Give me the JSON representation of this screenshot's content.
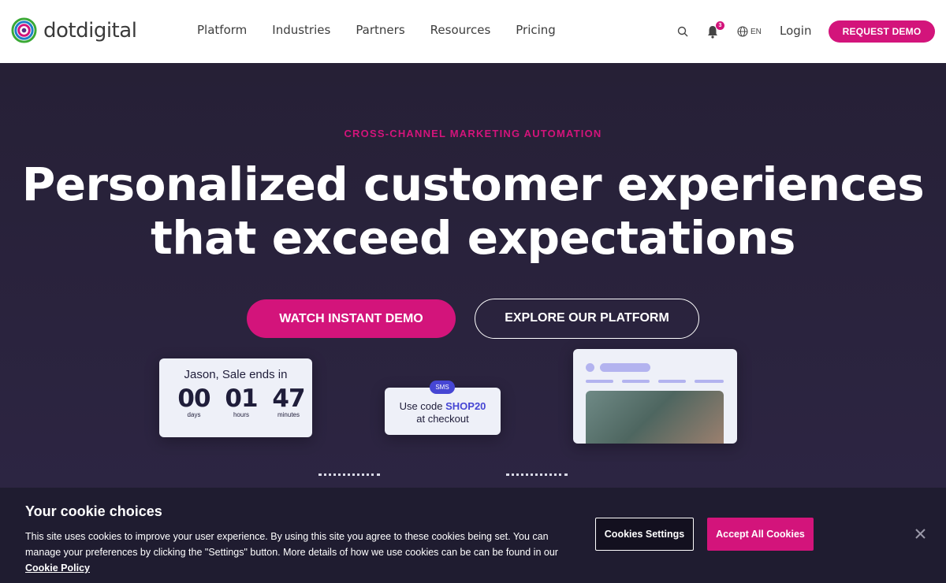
{
  "header": {
    "brand": "dotdigital",
    "nav": [
      "Platform",
      "Industries",
      "Partners",
      "Resources",
      "Pricing"
    ],
    "notification_count": "3",
    "language": "EN",
    "login_label": "Login",
    "request_demo_label": "REQUEST DEMO"
  },
  "hero": {
    "eyebrow": "CROSS-CHANNEL MARKETING AUTOMATION",
    "headline_line1": "Personalized customer experiences",
    "headline_line2": "that exceed expectations",
    "watch_demo_label": "WATCH INSTANT DEMO",
    "explore_label": "EXPLORE OUR PLATFORM"
  },
  "illustration": {
    "countdown_title": "Jason, Sale ends in",
    "countdown": [
      {
        "value": "00",
        "unit": "days"
      },
      {
        "value": "01",
        "unit": "hours"
      },
      {
        "value": "47",
        "unit": "minutes"
      }
    ],
    "sms_tag": "SMS",
    "sms_prefix": "Use code",
    "sms_code": "SHOP20",
    "sms_suffix": "at checkout"
  },
  "cookie_banner": {
    "title": "Your cookie choices",
    "body": "This site uses cookies to improve your user experience. By using this site you agree to these cookies being set. You can manage your preferences by clicking the \"Settings\" button. More details of how we use cookies can be can be found in our",
    "link_label": "Cookie Policy",
    "settings_label": "Cookies Settings",
    "accept_label": "Accept All Cookies"
  },
  "colors": {
    "brand_pink": "#d3147b",
    "hero_bg": "#2b2541",
    "accent_blue": "#4646d4"
  },
  "icons": [
    "dotdigital-logo-icon",
    "search-icon",
    "bell-icon",
    "globe-icon",
    "close-icon"
  ]
}
